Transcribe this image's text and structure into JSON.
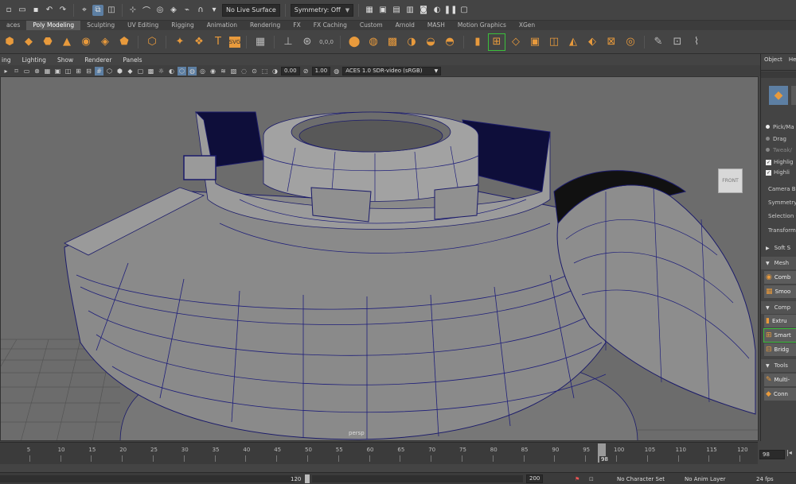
{
  "status_line": {
    "live_surface": "No Live Surface",
    "symmetry": "Symmetry: Off"
  },
  "shelf_tabs": [
    "aces",
    "Poly Modeling",
    "Sculpting",
    "UV Editing",
    "Rigging",
    "Animation",
    "Rendering",
    "FX",
    "FX Caching",
    "Custom",
    "Arnold",
    "MASH",
    "Motion Graphics",
    "XGen"
  ],
  "shelf_active_tab": "Poly Modeling",
  "shelf": {
    "text_tool_glyph": "T",
    "svg_tool_label": "SVG",
    "pct_label": "0,0,0"
  },
  "panel_menu": [
    "ing",
    "Lighting",
    "Show",
    "Renderer",
    "Panels"
  ],
  "panel_toolbar": {
    "exposure": "0.00",
    "gamma": "1.00",
    "color_space": "ACES 1.0 SDR-video (sRGB)"
  },
  "viewport": {
    "viewcube_label": "FRONT",
    "camera_name": "persp"
  },
  "side_panel": {
    "tabs": [
      "Object",
      "He"
    ],
    "pick_mode": "Pick/Ma",
    "drag": "Drag",
    "tweak": "Tweak/",
    "highlight1": "Highlig",
    "highlight2": "Highli",
    "camera_based": "Camera Bas",
    "symmetry": "Symmetry",
    "selection": "Selection C",
    "transform": "Transform C",
    "soft_select": "Soft S",
    "mesh_header": "Mesh",
    "combine": "Comb",
    "smooth": "Smoo",
    "components_header": "Comp",
    "extrude": "Extru",
    "smart": "Smart",
    "bridge": "Bridg",
    "tools_header": "Tools",
    "multicut": "Multi-",
    "connect": "Conn"
  },
  "time_slider": {
    "ticks": [
      "5",
      "10",
      "15",
      "20",
      "25",
      "30",
      "35",
      "40",
      "45",
      "50",
      "55",
      "60",
      "65",
      "70",
      "75",
      "80",
      "85",
      "90",
      "95",
      "100",
      "105",
      "110",
      "115",
      "120"
    ],
    "current_frame": "98",
    "current_frame_field": "98"
  },
  "range_slider": {
    "end_value": "120",
    "anim_end": "200",
    "character_set": "No Character Set",
    "anim_layer": "No Anim Layer",
    "fps": "24 fps"
  }
}
